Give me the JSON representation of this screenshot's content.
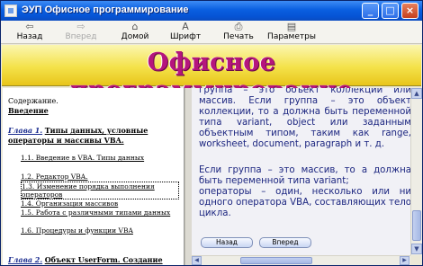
{
  "window": {
    "title": "ЭУП Офисное программирование",
    "minimize": "_",
    "maximize": "□",
    "close": "×"
  },
  "toolbar": {
    "back": {
      "label": "Назад",
      "icon": "back-arrow-icon",
      "glyph": "⇦"
    },
    "forward": {
      "label": "Вперед",
      "icon": "forward-arrow-icon",
      "glyph": "⇨",
      "disabled": true
    },
    "home": {
      "label": "Домой",
      "icon": "home-icon",
      "glyph": "⌂"
    },
    "font": {
      "label": "Шрифт",
      "icon": "font-icon",
      "glyph": "A"
    },
    "print": {
      "label": "Печать",
      "icon": "printer-icon",
      "glyph": "⎙"
    },
    "options": {
      "label": "Параметры",
      "icon": "options-icon",
      "glyph": "▤"
    }
  },
  "banner": {
    "title": "Офисное программирование"
  },
  "toc": {
    "contents_label": "Содержание.",
    "intro": "Введение",
    "chapter1": {
      "num": "Глава 1.",
      "title": "Типы данных, условные операторы и массивы VBA."
    },
    "subs": [
      "1.1. Введение в VBA. Типы данных",
      "1.2. Редактор VBA.",
      "1.3. Изменение порядка выполнения операторов",
      "1.4. Организация массивов",
      "1.5. Работа с различными типами данных",
      "1.6. Процедуры и функции VBA"
    ],
    "chapter2": {
      "num": "Глава 2.",
      "title": "Объект UserForm. Создание VBA-"
    }
  },
  "content": {
    "paragraphs": [
      "группа – это объект коллекции или массив. Если группа – это объект коллекции, то а должна быть переменной типа variant, object или заданным объектным типом, таким как range, worksheet, document, paragraph и т. д.",
      "Если группа – это массив, то а должна быть переменной типа variant;",
      "операторы – один, несколько или ни одного оператора VBA, составляющих тело цикла."
    ],
    "back_button": "Назад",
    "forward_button": "Вперед"
  },
  "colors": {
    "titlebar": "#0a5fe0",
    "banner_text": "#b5157d",
    "banner_bg": "#f4e24a",
    "content_text": "#1c2680"
  }
}
